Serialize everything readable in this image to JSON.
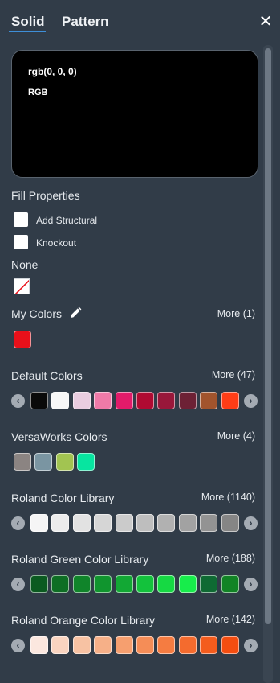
{
  "tabs": {
    "solid": "Solid",
    "pattern": "Pattern"
  },
  "close_glyph": "✕",
  "preview": {
    "value": "rgb(0, 0, 0)",
    "mode": "RGB"
  },
  "fill_properties": {
    "title": "Fill Properties",
    "add_structural": "Add Structural",
    "knockout": "Knockout"
  },
  "none": {
    "title": "None"
  },
  "my_colors": {
    "title": "My Colors",
    "more": "More (1)",
    "colors": [
      "#e8101a"
    ]
  },
  "default_colors": {
    "title": "Default Colors",
    "more": "More (47)",
    "colors": [
      "#0a0a0a",
      "#f7f7f7",
      "#e9cde0",
      "#ef7aa8",
      "#e21b6a",
      "#b00a32",
      "#99173a",
      "#6d2135",
      "#a2542d",
      "#ff3d17"
    ]
  },
  "versaworks_colors": {
    "title": "VersaWorks Colors",
    "more": "More (4)",
    "colors": [
      "#8b8482",
      "#7a95a2",
      "#a2c451",
      "#07e5a0"
    ]
  },
  "roland_color_library": {
    "title": "Roland Color Library",
    "more": "More (1140)",
    "colors": [
      "#f5f5f5",
      "#ececec",
      "#e2e2e2",
      "#d6d6d6",
      "#cbcbcb",
      "#bebebe",
      "#b1b1b1",
      "#a2a2a2",
      "#939393",
      "#858585"
    ]
  },
  "roland_green_color_library": {
    "title": "Roland Green Color Library",
    "more": "More (188)",
    "colors": [
      "#0b5a20",
      "#0e6e24",
      "#10842a",
      "#10952e",
      "#12a834",
      "#13c23c",
      "#16d943",
      "#17ed4b",
      "#0f6a33",
      "#118325"
    ]
  },
  "roland_orange_color_library": {
    "title": "Roland Orange Color Library",
    "more": "More (142)",
    "colors": [
      "#fbe7df",
      "#f9d4c0",
      "#f7c2a3",
      "#f6b088",
      "#f69f6f",
      "#f58d57",
      "#f57c41",
      "#f46b2e",
      "#f45c1d",
      "#f44d10"
    ]
  },
  "arrows": {
    "left": "‹",
    "right": "›"
  }
}
